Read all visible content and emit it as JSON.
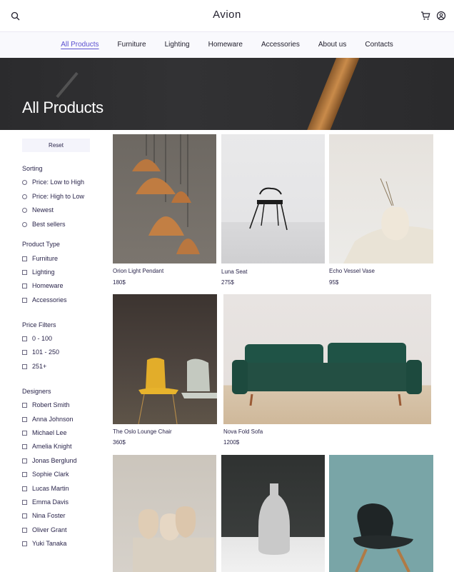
{
  "header": {
    "brand": "Avion",
    "search_icon": "search-icon",
    "cart_icon": "cart-icon",
    "user_icon": "user-icon"
  },
  "nav": {
    "items": [
      {
        "label": "All Products",
        "active": true
      },
      {
        "label": "Furniture"
      },
      {
        "label": "Lighting"
      },
      {
        "label": "Homeware"
      },
      {
        "label": "Accessories"
      },
      {
        "label": "About us"
      },
      {
        "label": "Contacts"
      }
    ]
  },
  "hero": {
    "title": "All Products"
  },
  "filters": {
    "reset_label": "Reset",
    "sorting": {
      "title": "Sorting",
      "options": [
        "Price: Low to High",
        "Price: High to Low",
        "Newest",
        "Best sellers"
      ]
    },
    "product_type": {
      "title": "Product Type",
      "options": [
        "Furniture",
        "Lighting",
        "Homeware",
        "Accessories"
      ]
    },
    "price": {
      "title": "Price Filters",
      "options": [
        "0 - 100",
        "101 - 250",
        "251+"
      ]
    },
    "designers": {
      "title": "Designers",
      "options": [
        "Robert Smith",
        "Anna Johnson",
        "Michael Lee",
        "Amelia Knight",
        "Jonas Berglund",
        "Sophie Clark",
        "Lucas Martin",
        "Emma Davis",
        "Nina Foster",
        "Oliver Grant",
        "Yuki Tanaka"
      ]
    }
  },
  "products": [
    {
      "name": "Orion Light Pendant",
      "price": "180$"
    },
    {
      "name": "Luna Seat",
      "price": "275$"
    },
    {
      "name": "Echo Vessel Vase",
      "price": "95$"
    },
    {
      "name": "The Oslo Lounge Chair",
      "price": "360$"
    },
    {
      "name": "Nova Fold Sofa",
      "price": "1200$"
    },
    {
      "name": "",
      "price": ""
    },
    {
      "name": "",
      "price": ""
    },
    {
      "name": "",
      "price": ""
    }
  ],
  "colors": {
    "accent": "#5a4fd0",
    "text": "#2a254b",
    "nav_bg": "#f9f9fd"
  }
}
